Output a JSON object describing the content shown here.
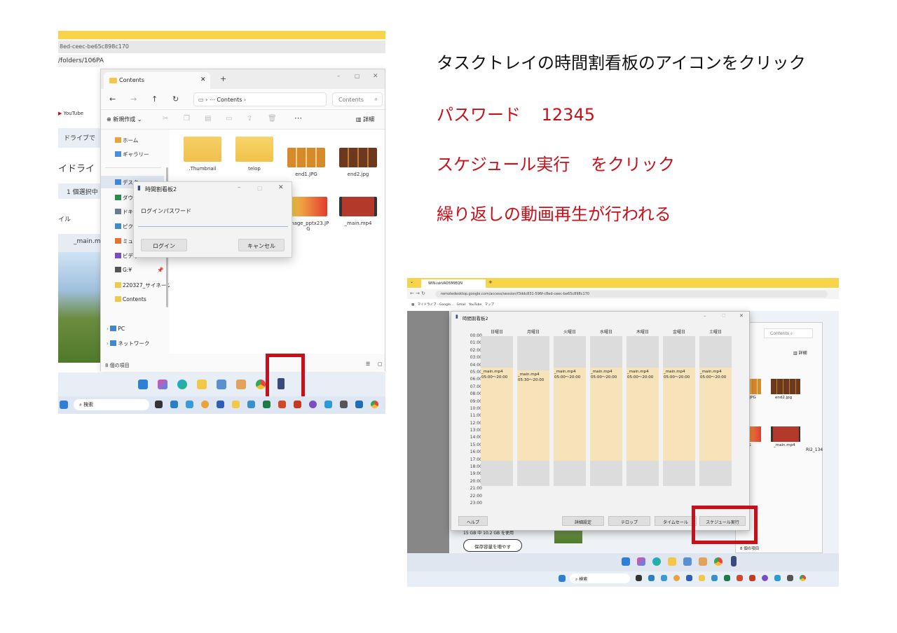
{
  "instructions": {
    "step1": "タスクトレイの時間割看板のアイコンをクリック",
    "step2_label": "パスワード",
    "step2_value": "12345",
    "step3_label": "スケジュール実行",
    "step3_suffix": "をクリック",
    "step4": "繰り返しの動画再生が行われる",
    "colors": {
      "black": "#111111",
      "red": "#c8101a"
    }
  },
  "left_screenshot": {
    "url_fragment": "8ed-ceec-be65c898c170",
    "background": {
      "folders_path": "/folders/106PA",
      "bookmark_youtube": "YouTube",
      "drive_label": "ドライブで",
      "drive_title": "イドライ",
      "selected": "1 個選択中",
      "file_label": "イル",
      "main_file": "_main.m"
    },
    "explorer": {
      "tab_title": "Contents",
      "address_crumb": "Contents",
      "search_placeholder": "Contents",
      "new_button": "新規作成",
      "details_button": "詳細",
      "sidebar": [
        "ホーム",
        "ギャラリー",
        "デスク",
        "ダウン",
        "ドキュ",
        "ピクチ",
        "ミュー",
        "ビデオ",
        "G:¥",
        "220327_サイネージ",
        "Contents",
        "PC",
        "ネットワーク"
      ],
      "files": [
        {
          "name": ".Thumbnail",
          "kind": "folder"
        },
        {
          "name": "telop",
          "kind": "folder"
        },
        {
          "name": "end1.JPG",
          "kind": "image"
        },
        {
          "name": "end2.jpg",
          "kind": "image"
        },
        {
          "name": "gnage_pptx23.JPG",
          "kind": "image"
        },
        {
          "name": "_main.mp4",
          "kind": "video"
        }
      ],
      "status": "8 個の項目"
    },
    "login_dialog": {
      "title": "時間割看板2",
      "label": "ログインパスワード",
      "login_button": "ログイン",
      "cancel_button": "キャンセル"
    },
    "taskbar": {
      "search_placeholder": "検索"
    }
  },
  "right_screenshot": {
    "tab_title": "WIN-iskVAD5MIEQN",
    "url": "remotedesktop.google.com/access/session/f3ddc831-596f-c8ed-ceec-be65c898c170",
    "bookmarks": [
      "マイドライブ - Google...",
      "Gmail",
      "YouTube",
      "マップ"
    ],
    "explorer": {
      "search_placeholder": "Contents",
      "details_button": "詳細",
      "files": [
        "end1.JPG",
        "end2.jpg",
        "PG",
        "_main.mp4"
      ],
      "extra": "RI2_134",
      "status": "8 個の項目"
    },
    "storage_text": "15 GB 中 10.2 GB を使用",
    "storage_button": "保存容量を増やす",
    "schedule": {
      "title": "時間割看板2",
      "days": [
        "日曜日",
        "月曜日",
        "火曜日",
        "水曜日",
        "木曜日",
        "金曜日",
        "土曜日"
      ],
      "hours": [
        "00:00",
        "01:00",
        "02:00",
        "03:00",
        "04:00",
        "05:00",
        "06:00",
        "07:00",
        "08:00",
        "09:00",
        "10:00",
        "11:00",
        "12:00",
        "13:00",
        "14:00",
        "15:00",
        "16:00",
        "17:00",
        "18:00",
        "19:00",
        "20:00",
        "21:00",
        "22:00",
        "23:00"
      ],
      "entries": [
        {
          "file": "_main.mp4",
          "time": "05:00〜20:00"
        },
        {
          "file": "_main.mp4",
          "time": "05:30〜20:00"
        },
        {
          "file": "_main.mp4",
          "time": "05:00〜20:00"
        },
        {
          "file": "_main.mp4",
          "time": "05:00〜20:00"
        },
        {
          "file": "_main.mp4",
          "time": "05:00〜20:00"
        },
        {
          "file": "_main.mp4",
          "time": "05:00〜20:00"
        },
        {
          "file": "_main.mp4",
          "time": "05:00〜20:00"
        }
      ],
      "buttons": {
        "help": "ヘルプ",
        "detail": "詳細設定",
        "telop": "テロップ",
        "timesale": "タイムセール",
        "run": "スケジュール実行"
      }
    },
    "taskbar": {
      "search_placeholder": "検索"
    }
  }
}
